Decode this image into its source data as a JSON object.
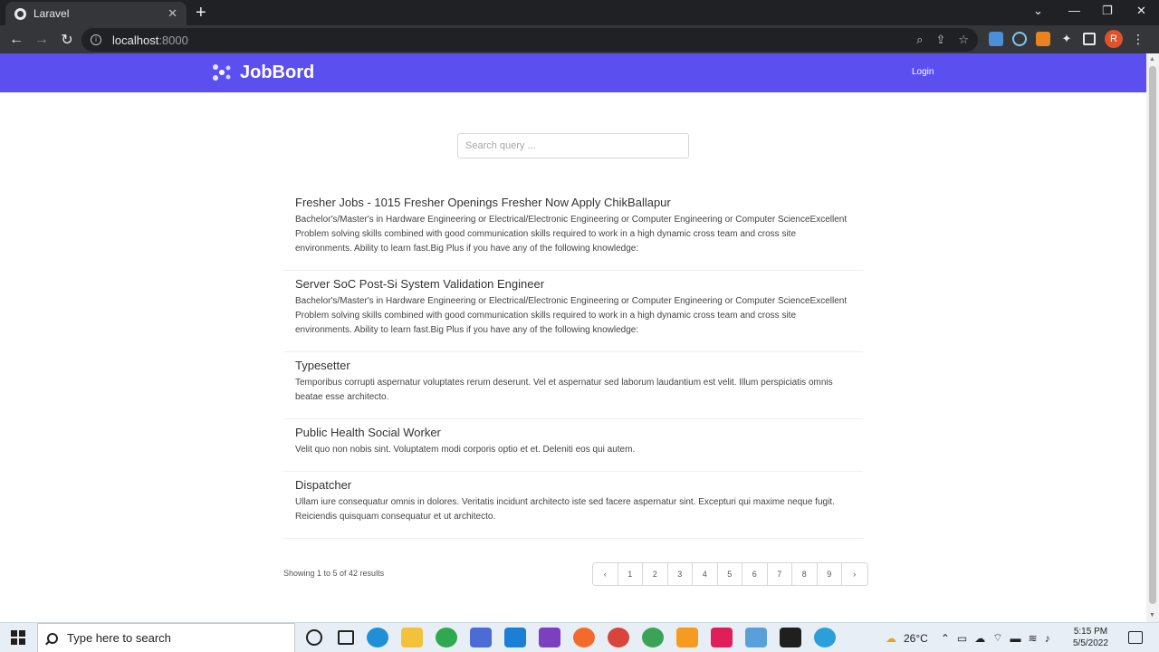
{
  "browser": {
    "tab_title": "Laravel",
    "url_host": "localhost",
    "url_port": ":8000",
    "avatar_letter": "R"
  },
  "site": {
    "brand": "JobBord",
    "login_label": "Login",
    "accent": "#5b4ff0"
  },
  "search": {
    "placeholder": "Search query ..."
  },
  "jobs": [
    {
      "title": "Fresher Jobs - 1015 Fresher Openings Fresher Now Apply ChikBallapur",
      "description": "Bachelor's/Master's in Hardware Engineering or Electrical/Electronic Engineering or Computer Engineering or Computer ScienceExcellent Problem solving skills combined with good communication skills required to work in a high dynamic cross team and cross site environments. Ability to learn fast.Big Plus if you have any of the following knowledge:"
    },
    {
      "title": "Server SoC Post-Si System Validation Engineer",
      "description": "Bachelor's/Master's in Hardware Engineering or Electrical/Electronic Engineering or Computer Engineering or Computer ScienceExcellent Problem solving skills combined with good communication skills required to work in a high dynamic cross team and cross site environments. Ability to learn fast.Big Plus if you have any of the following knowledge:"
    },
    {
      "title": "Typesetter",
      "description": "Temporibus corrupti aspernatur voluptates rerum deserunt. Vel et aspernatur sed laborum laudantium est velit. Illum perspiciatis omnis beatae esse architecto."
    },
    {
      "title": "Public Health Social Worker",
      "description": "Velit quo non nobis sint. Voluptatem modi corporis optio et et. Deleniti eos qui autem."
    },
    {
      "title": "Dispatcher",
      "description": "Ullam iure consequatur omnis in dolores. Veritatis incidunt architecto iste sed facere aspernatur sint. Excepturi qui maxime neque fugit. Reiciendis quisquam consequatur et ut architecto."
    }
  ],
  "pagination": {
    "summary": "Showing 1 to 5 of 42 results",
    "prev": "‹",
    "next": "›",
    "pages": [
      "1",
      "2",
      "3",
      "4",
      "5",
      "6",
      "7",
      "8",
      "9"
    ]
  },
  "taskbar": {
    "search_placeholder": "Type here to search",
    "weather": "26°C",
    "time": "5:15 PM",
    "date": "5/5/2022"
  }
}
